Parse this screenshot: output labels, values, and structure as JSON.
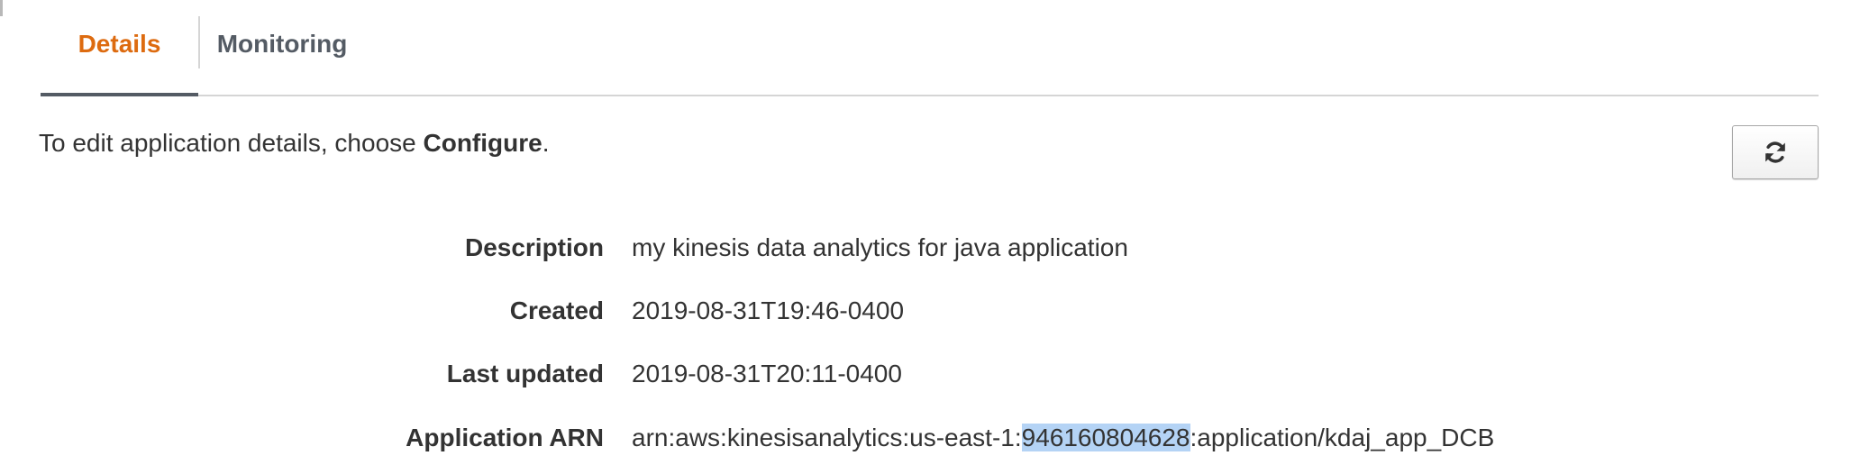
{
  "tabs": [
    {
      "label": "Details",
      "active": true
    },
    {
      "label": "Monitoring",
      "active": false
    }
  ],
  "info": {
    "prefix": "To edit application details, choose ",
    "action": "Configure",
    "suffix": "."
  },
  "refresh_button": {
    "icon": "refresh-icon"
  },
  "details": {
    "description": {
      "label": "Description",
      "value": "my kinesis data analytics for java application"
    },
    "created": {
      "label": "Created",
      "value": "2019-08-31T19:46-0400"
    },
    "last_updated": {
      "label": "Last updated",
      "value": "2019-08-31T20:11-0400"
    },
    "arn": {
      "label": "Application ARN",
      "value_prefix": "arn:aws:kinesisanalytics:us-east-1:",
      "value_selected": "946160804628",
      "value_suffix": ":application/kdaj_app_DCB"
    }
  },
  "colors": {
    "active_tab": "#dd6b10",
    "selection": "#b4d3f5"
  }
}
